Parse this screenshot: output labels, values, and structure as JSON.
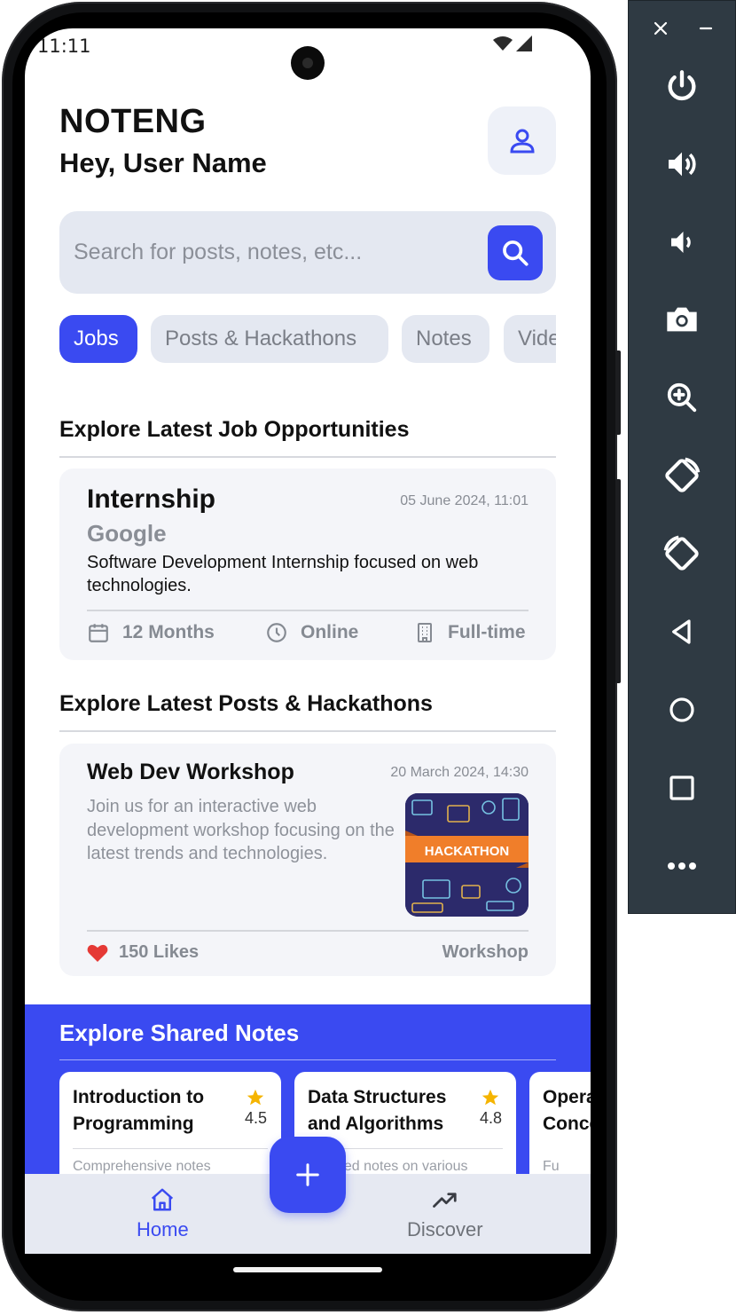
{
  "status": {
    "time": "11:11"
  },
  "header": {
    "app_name": "NOTENG",
    "greeting": "Hey, User Name"
  },
  "search": {
    "placeholder": "Search for posts, notes, etc..."
  },
  "chips": [
    {
      "label": "Jobs",
      "active": true
    },
    {
      "label": "Posts & Hackathons",
      "active": false
    },
    {
      "label": "Notes",
      "active": false
    },
    {
      "label": "Videos",
      "active": false
    }
  ],
  "jobs_section": {
    "title": "Explore Latest Job Opportunities",
    "card": {
      "title": "Internship",
      "date": "05 June 2024, 11:01",
      "company": "Google",
      "description": "Software Development Internship focused on web technologies.",
      "duration": "12 Months",
      "mode": "Online",
      "type": "Full-time"
    }
  },
  "posts_section": {
    "title": "Explore Latest Posts & Hackathons",
    "card": {
      "title": "Web Dev Workshop",
      "date": "20 March 2024, 14:30",
      "description": "Join us for an interactive web development workshop focusing on the latest trends and technologies.",
      "image_banner": "HACKATHON",
      "likes": "150 Likes",
      "tag": "Workshop"
    }
  },
  "notes_section": {
    "title": "Explore Shared Notes",
    "cards": [
      {
        "title": "Introduction to Programming",
        "rating": "4.5",
        "description": "Comprehensive notes"
      },
      {
        "title": "Data Structures and Algorithms",
        "rating": "4.8",
        "description": "Detailed notes on various"
      },
      {
        "title": "Operating Concepts",
        "rating": "",
        "description": "Fu"
      }
    ]
  },
  "bottom_nav": {
    "home": "Home",
    "discover": "Discover"
  },
  "colors": {
    "accent": "#3a4af1",
    "surface": "#f4f5f9",
    "chip": "#e4e8f1",
    "star": "#f5b400",
    "heart": "#e53935"
  },
  "icons": {
    "profile": "person-icon",
    "search": "search-icon",
    "calendar": "calendar-icon",
    "clock": "clock-icon",
    "building": "building-icon",
    "heart": "heart-icon",
    "star": "star-icon",
    "home": "home-icon",
    "trending": "trending-up-icon",
    "add": "plus-icon"
  },
  "emulator_toolbar": {
    "controls": [
      "close",
      "minimize"
    ],
    "buttons": [
      "power",
      "volume-up",
      "volume-down",
      "camera",
      "zoom",
      "rotate-left",
      "rotate-right",
      "back",
      "home",
      "overview",
      "more"
    ]
  }
}
